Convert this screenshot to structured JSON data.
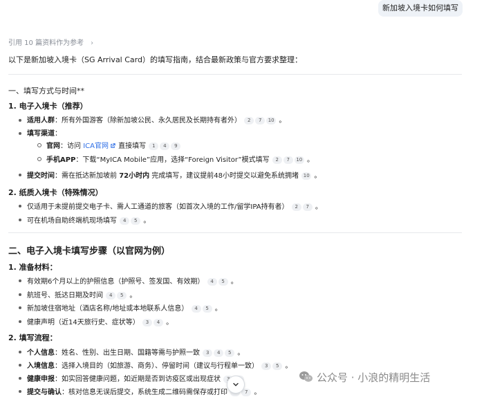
{
  "user_message": "新加坡入境卡如何填写",
  "refs": {
    "label": "引用 10 篇资料作为参考",
    "chevron": "chevron-right-icon"
  },
  "intro": "以下是新加坡入境卡（SG Arrival Card）的填写指南，结合最新政策与官方要求整理：",
  "section1": {
    "heading": "一、填写方式与时间**",
    "item1": {
      "title": "1. 电子入境卡（推荐）",
      "applicable_label": "适用人群",
      "applicable_text": "：所有外国游客（除新加坡公民、永久居民及长期持有者外）",
      "applicable_cites": [
        "2",
        "7",
        "10"
      ],
      "channel_label": "填写渠道",
      "channel_suffix": "：",
      "official_label": "官网",
      "official_text_pre": "：访问 ",
      "official_link": "ICA官网",
      "official_text_post": " 直接填写",
      "official_cites": [
        "1",
        "4",
        "9"
      ],
      "app_label": "手机APP",
      "app_text": "：下载“MyICA Mobile”应用，选择“Foreign Visitor”模式填写",
      "app_cites": [
        "2",
        "7",
        "10"
      ],
      "time_label": "提交时间",
      "time_text_pre": "：需在抵达新加坡前 ",
      "time_bold": "72小时内",
      "time_text_post": " 完成填写，建议提前48小时提交以避免系统拥堵",
      "time_cites": [
        "10"
      ]
    },
    "item2": {
      "title": "2. 纸质入境卡（特殊情况）",
      "line1": "仅适用于未提前提交电子卡、需人工通道的旅客（如首次入境的工作/留学IPA持有者）",
      "line1_cites": [
        "2",
        "7"
      ],
      "line2": "可在机场自助终端机现场填写",
      "line2_cites": [
        "4",
        "5"
      ]
    }
  },
  "section2": {
    "heading": "二、电子入境卡填写步骤（以官网为例）",
    "item1": {
      "title": "1. 准备材料：",
      "lines": [
        {
          "text": "有效期6个月以上的护照信息（护照号、签发国、有效期）",
          "cites": [
            "4",
            "5"
          ]
        },
        {
          "text": "航班号、抵达日期及时间",
          "cites": [
            "4",
            "5"
          ]
        },
        {
          "text": "新加坡住宿地址（酒店名称/地址或本地联系人信息）",
          "cites": [
            "4",
            "5"
          ]
        },
        {
          "text": "健康声明（近14天旅行史、症状等）",
          "cites": [
            "3",
            "4"
          ]
        }
      ]
    },
    "item2": {
      "title": "2. 填写流程：",
      "lines": [
        {
          "label": "个人信息",
          "text": "：姓名、性别、出生日期、国籍等需与护照一致",
          "cites": [
            "3",
            "4",
            "5"
          ]
        },
        {
          "label": "入境信息",
          "text": "：选择入境目的（如旅游、商务）、停留时间（建议与行程单一致）",
          "cites": [
            "3",
            "5"
          ]
        },
        {
          "label": "健康申报",
          "text": "：如实回答健康问题，如近期是否到访疫区或出现症状",
          "cites": [
            "3",
            "4"
          ]
        },
        {
          "label": "提交与确认",
          "text": "：核对信息无误后提交，系统生成二维码需保存或打印",
          "cites": [
            "4",
            "7"
          ]
        }
      ]
    }
  },
  "watermark": {
    "text": "公众号 · 小浪的精明生活",
    "icon": "wechat-icon"
  },
  "scroll_button": {
    "icon": "chevron-down-icon"
  }
}
